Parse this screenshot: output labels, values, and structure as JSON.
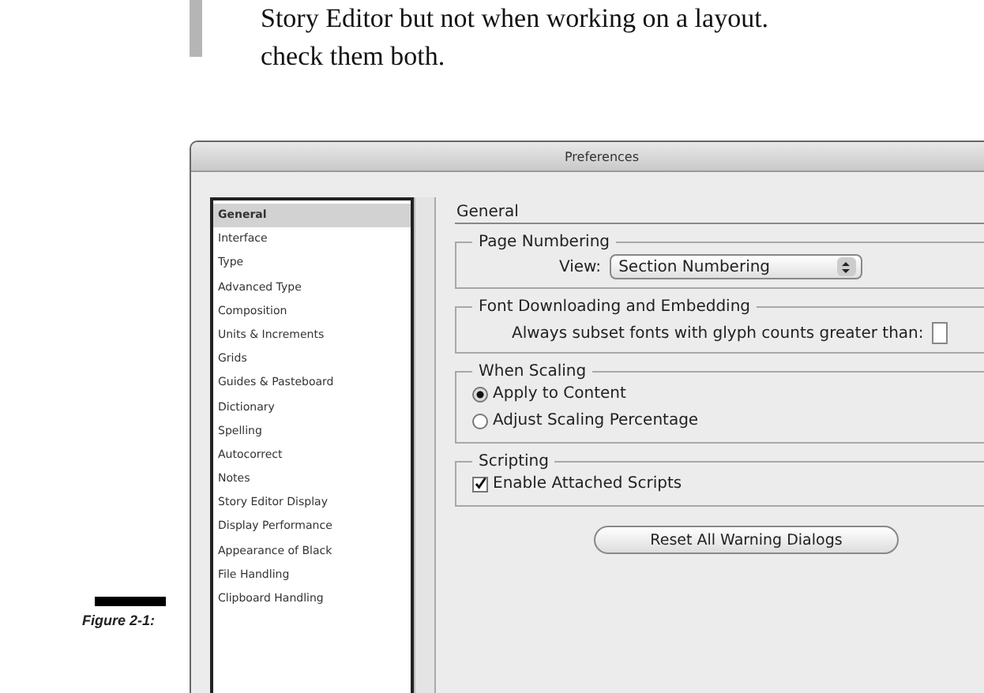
{
  "book_text": {
    "lines": [
      "Story Editor but not when working on a layout.",
      "check them both."
    ]
  },
  "figure_caption": "Figure 2-1:",
  "window": {
    "title": "Preferences"
  },
  "sidebar": {
    "items": [
      {
        "label": "General",
        "selected": true
      },
      {
        "label": "Interface",
        "selected": false
      },
      {
        "label": "Type",
        "selected": false
      },
      {
        "label": "Advanced Type",
        "selected": false
      },
      {
        "label": "Composition",
        "selected": false
      },
      {
        "label": "Units & Increments",
        "selected": false
      },
      {
        "label": "Grids",
        "selected": false
      },
      {
        "label": "Guides & Pasteboard",
        "selected": false
      },
      {
        "label": "Dictionary",
        "selected": false
      },
      {
        "label": "Spelling",
        "selected": false
      },
      {
        "label": "Autocorrect",
        "selected": false
      },
      {
        "label": "Notes",
        "selected": false
      },
      {
        "label": "Story Editor Display",
        "selected": false
      },
      {
        "label": "Display Performance",
        "selected": false
      },
      {
        "label": "Appearance of Black",
        "selected": false
      },
      {
        "label": "File Handling",
        "selected": false
      },
      {
        "label": "Clipboard Handling",
        "selected": false
      }
    ]
  },
  "panel": {
    "title": "General",
    "groups": [
      {
        "title": "Page Numbering",
        "kind": "select",
        "label": "View:",
        "value": "Section Numbering"
      },
      {
        "title": "Font Downloading and Embedding",
        "kind": "field",
        "label": "Always subset fonts with glyph counts greater than:"
      },
      {
        "title": "When Scaling",
        "kind": "radio",
        "options": [
          {
            "label": "Apply to Content",
            "selected": true
          },
          {
            "label": "Adjust Scaling Percentage",
            "selected": false
          }
        ]
      },
      {
        "title": "Scripting",
        "kind": "checkbox",
        "options": [
          {
            "label": "Enable Attached Scripts",
            "checked": true
          }
        ]
      }
    ],
    "buttons": [
      "Reset All Warning Dialogs"
    ]
  }
}
